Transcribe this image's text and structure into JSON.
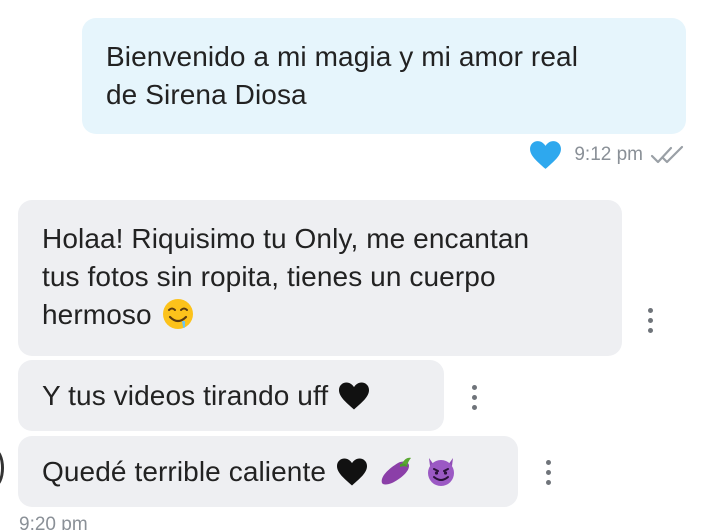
{
  "messages": {
    "outgoing": {
      "line1": "Bienvenido a mi magia y mi amor real",
      "line2": "de Sirena Diosa",
      "time": "9:12 pm",
      "liked": true
    },
    "incoming": [
      {
        "line1": "Holaa! Riquisimo tu Only, me encantan",
        "line2": "tus fotos sin ropita, tienes un cuerpo",
        "line3": "hermoso",
        "emojis": [
          "drooling-face"
        ]
      },
      {
        "text": "Y tus videos tirando uff",
        "emojis": [
          "black-heart"
        ]
      },
      {
        "text": "Quedé terrible caliente",
        "emojis": [
          "black-heart",
          "eggplant",
          "smiling-imp"
        ]
      }
    ],
    "incoming_time": "9:20 pm"
  },
  "icons": {
    "heart_reaction": "heart-icon",
    "read_receipt": "double-check-icon",
    "menu": "kebab-menu-icon"
  },
  "colors": {
    "outgoing_bubble": "#e6f5fc",
    "incoming_bubble": "#eeeff2",
    "heart": "#2ea8ee",
    "meta_text": "#8a9097"
  }
}
